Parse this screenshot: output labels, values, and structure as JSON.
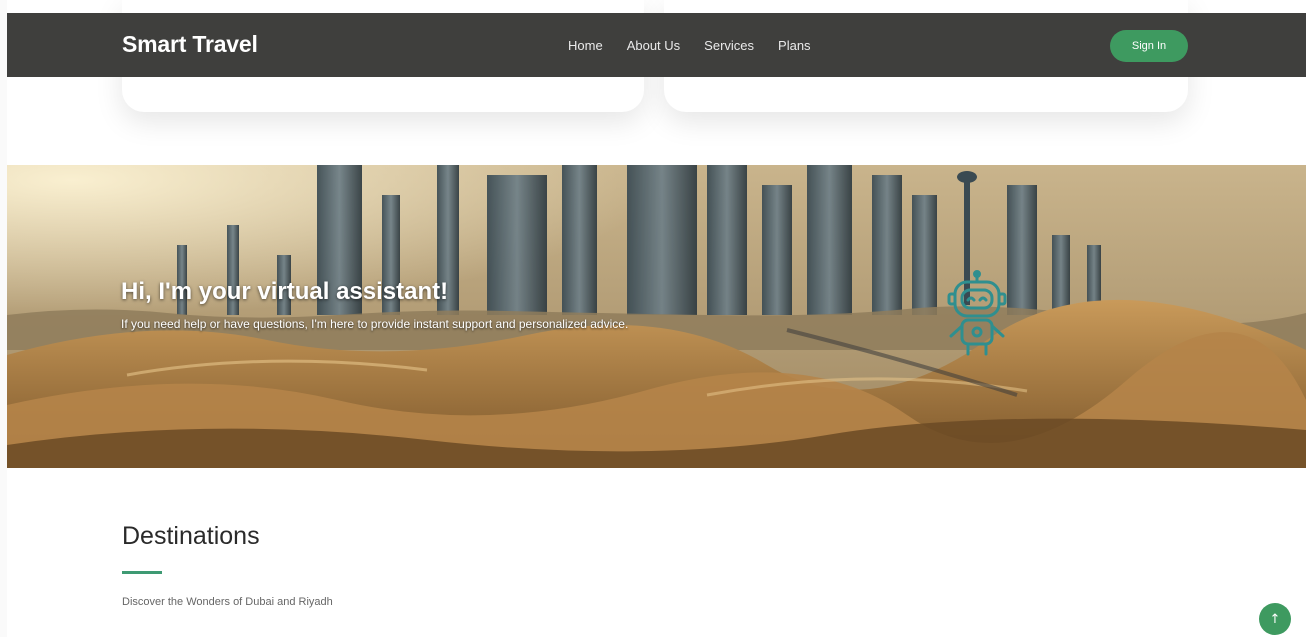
{
  "header": {
    "brand": "Smart Travel",
    "nav": [
      "Home",
      "About Us",
      "Services",
      "Plans"
    ],
    "signin_label": "Sign In"
  },
  "hero": {
    "title": "Hi, I'm your virtual assistant!",
    "subtitle": "If you need help or have questions, I'm here to provide instant support and personalized advice.",
    "assistant_icon": "robot-icon"
  },
  "destinations": {
    "title": "Destinations",
    "subtitle": "Discover the Wonders of Dubai and Riyadh"
  },
  "back_to_top": {
    "icon": "arrow-up-icon",
    "glyph": "↑"
  },
  "colors": {
    "header_bg": "#3f3f3d",
    "accent_green": "#3e9a60",
    "robot_teal": "#2f8f8f"
  }
}
